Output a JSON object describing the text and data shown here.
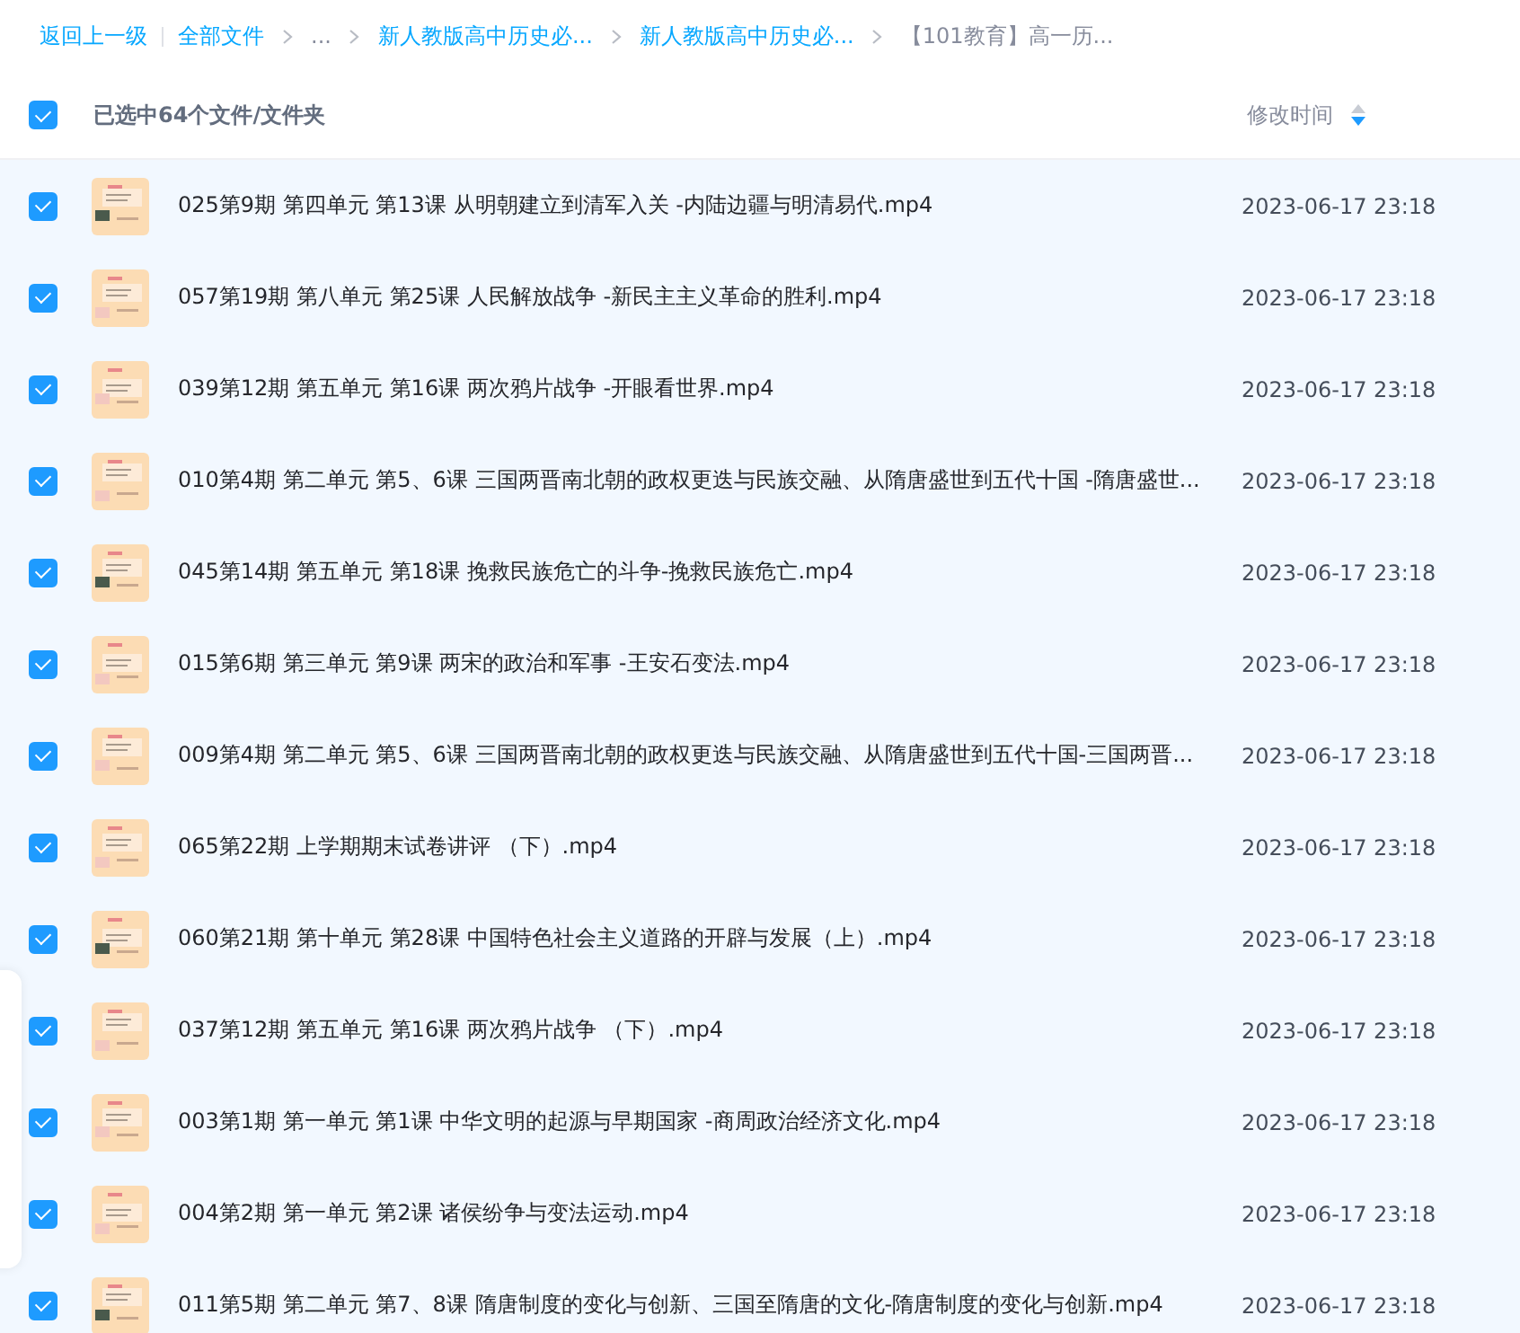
{
  "breadcrumb": {
    "back": "返回上一级",
    "items": [
      {
        "label": "全部文件",
        "link": true
      },
      {
        "label": "...",
        "link": false
      },
      {
        "label": "新人教版高中历史必...",
        "link": true
      },
      {
        "label": "新人教版高中历史必...",
        "link": true
      },
      {
        "label": "【101教育】高一历...",
        "link": false
      }
    ]
  },
  "header": {
    "selected": true,
    "label": "已选中64个文件/文件夹",
    "time_label": "修改时间",
    "sort_descending": true
  },
  "rows": [
    {
      "name": "025第9期 第四单元 第13课 从明朝建立到清军入关 -内陆边疆与明清易代.mp4",
      "time": "2023-06-17 23:18",
      "selected": true
    },
    {
      "name": "057第19期 第八单元 第25课 人民解放战争 -新民主主义革命的胜利.mp4",
      "time": "2023-06-17 23:18",
      "selected": true
    },
    {
      "name": "039第12期 第五单元 第16课 两次鸦片战争 -开眼看世界.mp4",
      "time": "2023-06-17 23:18",
      "selected": true
    },
    {
      "name": "010第4期 第二单元 第5、6课 三国两晋南北朝的政权更迭与民族交融、从隋唐盛世到五代十国 -隋唐盛世...",
      "time": "2023-06-17 23:18",
      "selected": true
    },
    {
      "name": "045第14期 第五单元 第18课 挽救民族危亡的斗争-挽救民族危亡.mp4",
      "time": "2023-06-17 23:18",
      "selected": true
    },
    {
      "name": "015第6期 第三单元 第9课 两宋的政治和军事 -王安石变法.mp4",
      "time": "2023-06-17 23:18",
      "selected": true
    },
    {
      "name": "009第4期 第二单元 第5、6课 三国两晋南北朝的政权更迭与民族交融、从隋唐盛世到五代十国-三国两晋...",
      "time": "2023-06-17 23:18",
      "selected": true
    },
    {
      "name": "065第22期 上学期期末试卷讲评 （下）.mp4",
      "time": "2023-06-17 23:18",
      "selected": true
    },
    {
      "name": "060第21期 第十单元 第28课 中国特色社会主义道路的开辟与发展（上）.mp4",
      "time": "2023-06-17 23:18",
      "selected": true
    },
    {
      "name": "037第12期 第五单元 第16课 两次鸦片战争 （下）.mp4",
      "time": "2023-06-17 23:18",
      "selected": true
    },
    {
      "name": "003第1期 第一单元 第1课 中华文明的起源与早期国家 -商周政治经济文化.mp4",
      "time": "2023-06-17 23:18",
      "selected": true
    },
    {
      "name": "004第2期 第一单元 第2课 诸侯纷争与变法运动.mp4",
      "time": "2023-06-17 23:18",
      "selected": true
    },
    {
      "name": "011第5期 第二单元 第7、8课 隋唐制度的变化与创新、三国至隋唐的文化-隋唐制度的变化与创新.mp4",
      "time": "2023-06-17 23:18",
      "selected": true
    }
  ]
}
